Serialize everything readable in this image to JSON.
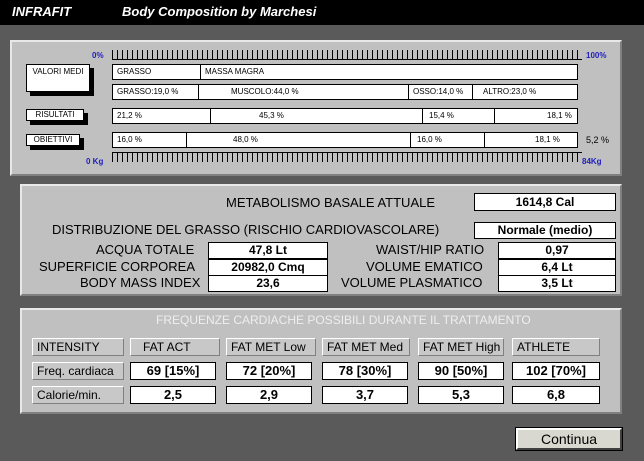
{
  "title": {
    "app": "INFRAFIT",
    "subtitle": "Body Composition by Marchesi"
  },
  "composition": {
    "scale_top_left": "0%",
    "scale_top_right": "100%",
    "scale_bottom_left": "0 Kg",
    "scale_bottom_right": "84Kg",
    "valori_label": "VALORI MEDI",
    "valori_row1": [
      "GRASSO",
      "MASSA MAGRA"
    ],
    "valori_row2": [
      "GRASSO:19,0 %",
      "MUSCOLO:44,0 %",
      "OSSO:14,0 %",
      "ALTRO:23,0 %"
    ],
    "risultati_label": "RISULTATI",
    "risultati": [
      "21,2 %",
      "45,3 %",
      "15,4 %",
      "18,1 %"
    ],
    "obiettivi_label": "OBIETTIVI",
    "obiettivi": [
      "16,0 %",
      "48,0 %",
      "16,0 %",
      "18,1 %"
    ],
    "obiettivi_extra": "5,2 %"
  },
  "metabolism": {
    "basal_label": "METABOLISMO BASALE ATTUALE",
    "basal_value": "1614,8 Cal",
    "fat_distribution_label": "DISTRIBUZIONE DEL GRASSO (RISCHIO CARDIOVASCOLARE)",
    "fat_distribution_value": "Normale (medio)",
    "left": [
      {
        "label": "ACQUA TOTALE",
        "value": "47,8 Lt"
      },
      {
        "label": "SUPERFICIE CORPOREA",
        "value": "20982,0 Cmq"
      },
      {
        "label": "BODY MASS INDEX",
        "value": "23,6"
      }
    ],
    "right": [
      {
        "label": "WAIST/HIP RATIO",
        "value": "0,97"
      },
      {
        "label": "VOLUME EMATICO",
        "value": "6,4 Lt"
      },
      {
        "label": "VOLUME PLASMATICO",
        "value": "3,5 Lt"
      }
    ]
  },
  "heart": {
    "title": "FREQUENZE CARDIACHE POSSIBILI DURANTE IL TRATTAMENTO",
    "row_labels": [
      "INTENSITY",
      "Freq. cardiaca",
      "Calorie/min."
    ],
    "columns": [
      "FAT  ACT",
      "FAT MET Low",
      "FAT MET Med",
      "FAT MET High",
      "ATHLETE"
    ],
    "freq": [
      "69 [15%]",
      "72 [20%]",
      "78 [30%]",
      "90 [50%]",
      "102 [70%]"
    ],
    "calories": [
      "2,5",
      "2,9",
      "3,7",
      "5,3",
      "6,8"
    ]
  },
  "continue_label": "Continua",
  "colors": {
    "panel": "#c0c0c0",
    "titlebar": "#000000",
    "background": "#5a5a5a",
    "scale_text": "#2020c0"
  }
}
